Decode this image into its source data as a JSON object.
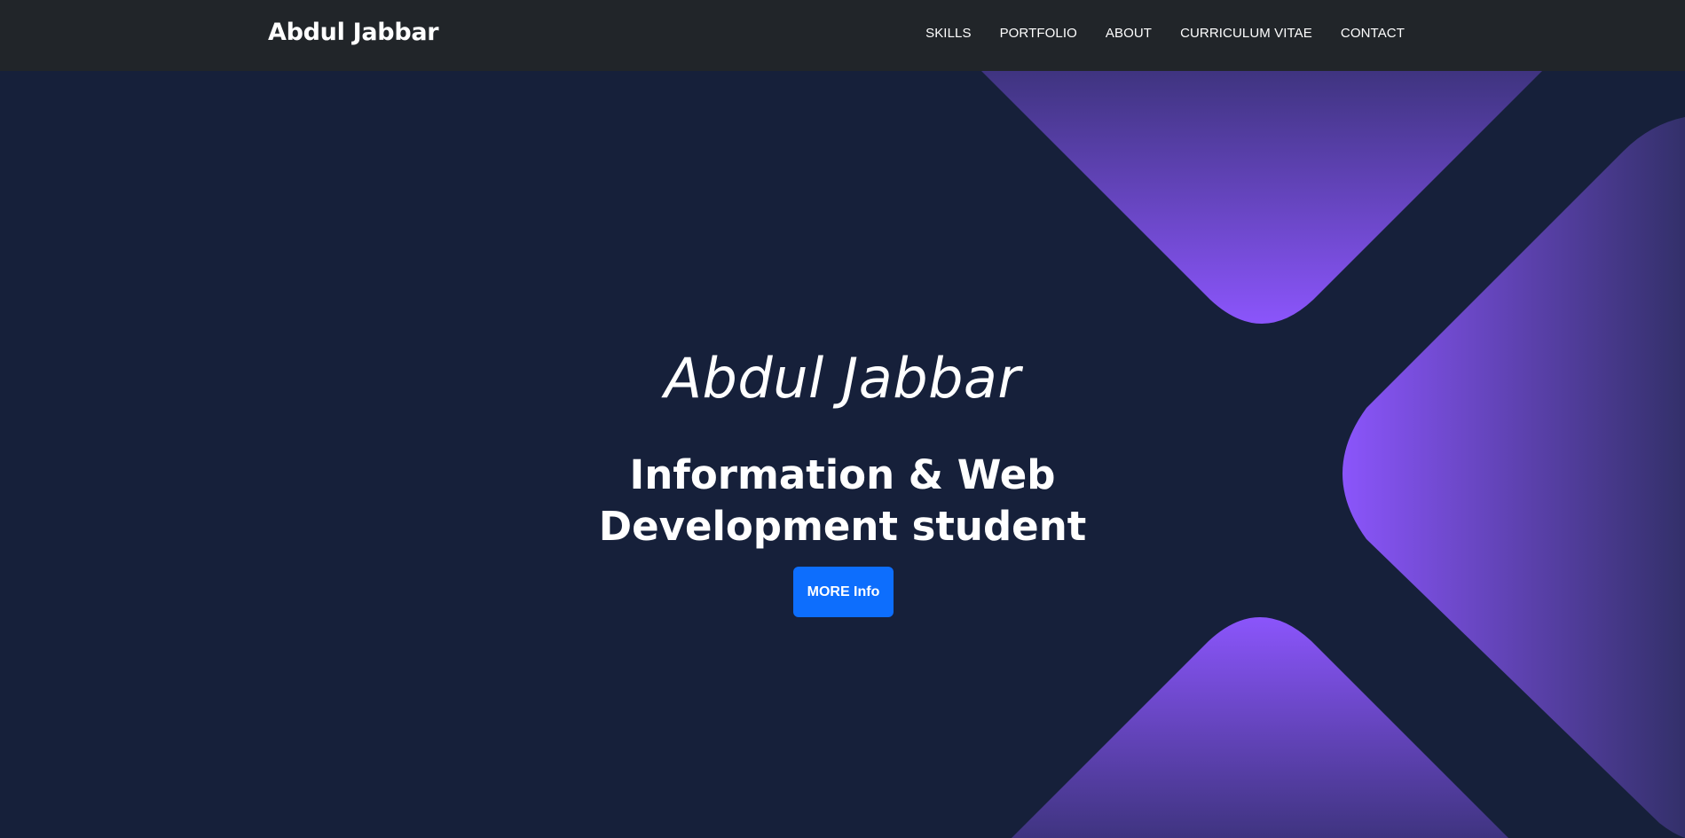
{
  "navbar": {
    "brand": "Abdul Jabbar",
    "links": [
      "SKILLS",
      "PORTFOLIO",
      "ABOUT",
      "CURRICULUM VITAE",
      "CONTACT"
    ]
  },
  "hero": {
    "name": "Abdul Jabbar",
    "title": "Information & Web Development student",
    "button_label": "MORE Info"
  },
  "colors": {
    "navbar_bg": "#212529",
    "hero_bg": "#16203a",
    "accent_purple": "#8b55fb",
    "button_blue": "#0d6efd"
  }
}
